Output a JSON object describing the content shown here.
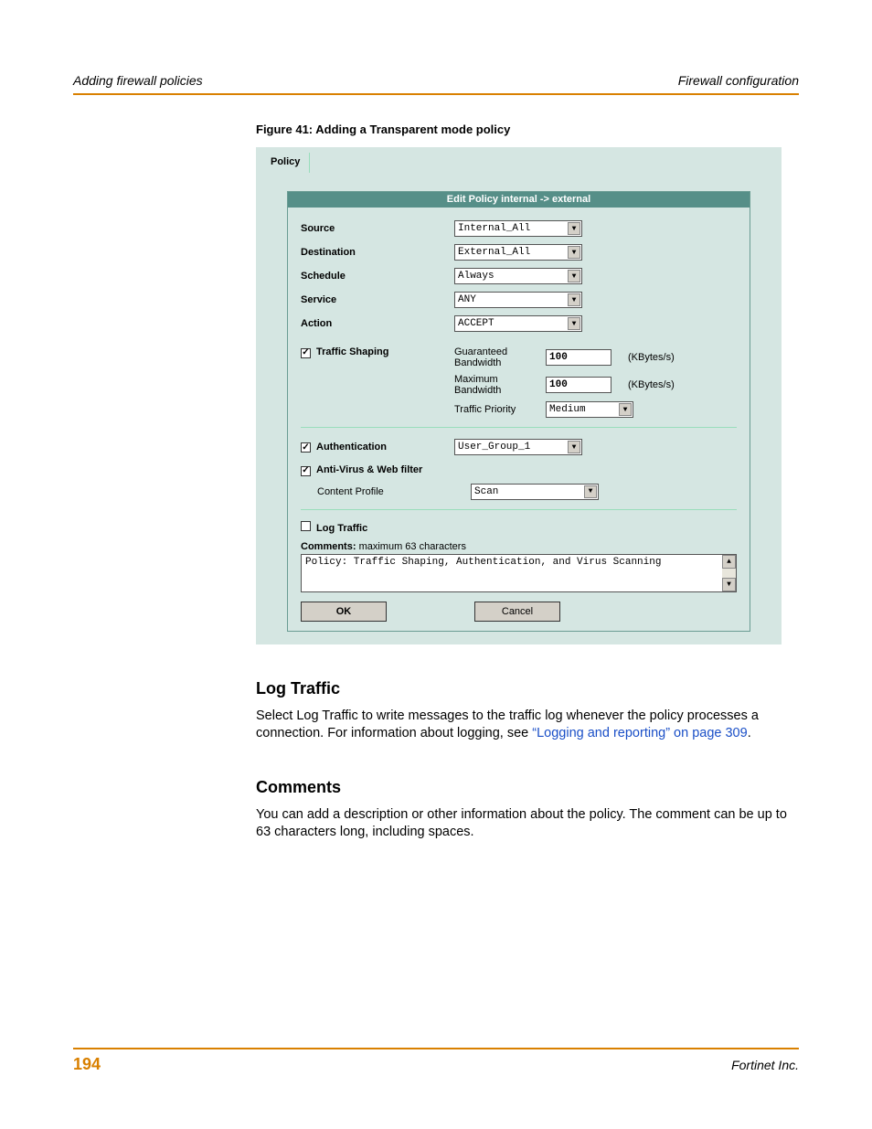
{
  "header": {
    "left": "Adding firewall policies",
    "right": "Firewall configuration"
  },
  "figure_caption": "Figure 41: Adding a Transparent mode policy",
  "screenshot": {
    "tab_label": "Policy",
    "form_title": "Edit Policy internal -> external",
    "rows": {
      "source_label": "Source",
      "source_value": "Internal_All",
      "destination_label": "Destination",
      "destination_value": "External_All",
      "schedule_label": "Schedule",
      "schedule_value": "Always",
      "service_label": "Service",
      "service_value": "ANY",
      "action_label": "Action",
      "action_value": "ACCEPT"
    },
    "traffic_shaping": {
      "checked": true,
      "label": "Traffic Shaping",
      "guaranteed_label": "Guaranteed Bandwidth",
      "guaranteed_value": "100",
      "guaranteed_unit": "(KBytes/s)",
      "maximum_label": "Maximum Bandwidth",
      "maximum_value": "100",
      "maximum_unit": "(KBytes/s)",
      "priority_label": "Traffic Priority",
      "priority_value": "Medium"
    },
    "authentication": {
      "checked": true,
      "label": "Authentication",
      "value": "User_Group_1"
    },
    "antivirus": {
      "checked": true,
      "label": "Anti-Virus & Web filter",
      "profile_label": "Content Profile",
      "profile_value": "Scan"
    },
    "log_traffic": {
      "checked": false,
      "label": "Log Traffic"
    },
    "comments_label": "Comments:",
    "comments_hint": "maximum 63 characters",
    "comments_value": "Policy: Traffic Shaping, Authentication, and Virus Scanning",
    "ok_label": "OK",
    "cancel_label": "Cancel"
  },
  "sections": {
    "log_traffic": {
      "heading": "Log Traffic",
      "text_pre": "Select Log Traffic to write messages to the traffic log whenever the policy processes a connection. For information about logging, see ",
      "link": "“Logging and reporting” on page 309",
      "text_post": "."
    },
    "comments": {
      "heading": "Comments",
      "text": "You can add a description or other information about the policy. The comment can be up to 63 characters long, including spaces."
    }
  },
  "footer": {
    "page": "194",
    "right": "Fortinet Inc."
  }
}
